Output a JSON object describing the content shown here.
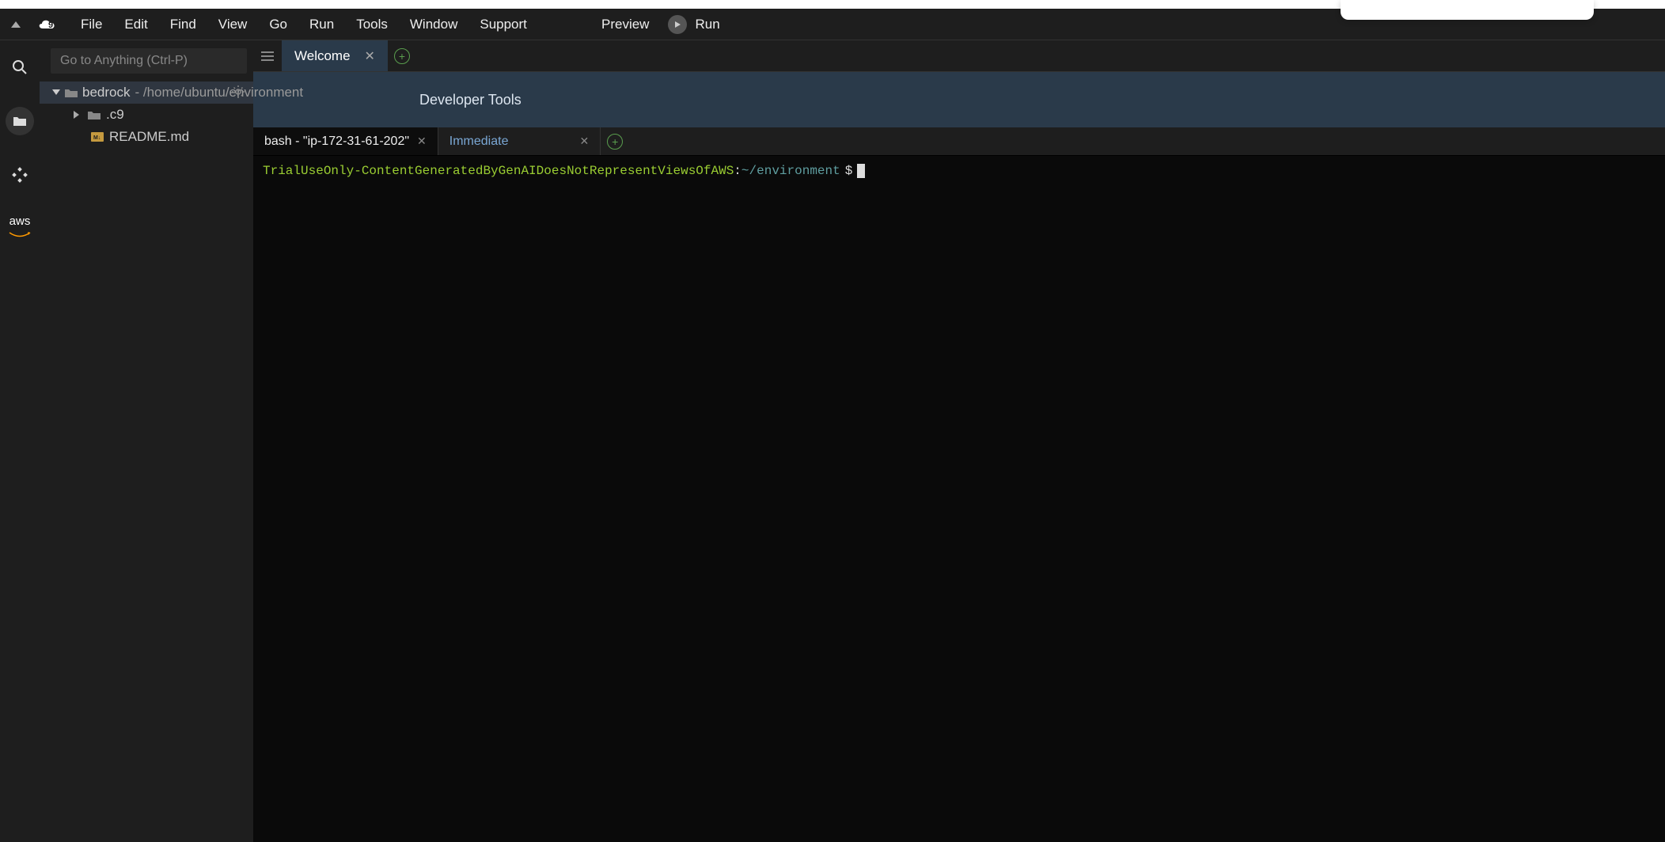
{
  "menubar": {
    "items": [
      "File",
      "Edit",
      "Find",
      "View",
      "Go",
      "Run",
      "Tools",
      "Window",
      "Support"
    ],
    "preview": "Preview",
    "run": "Run"
  },
  "sidebar": {
    "goto_placeholder": "Go to Anything (Ctrl-P)",
    "root": {
      "name": "bedrock",
      "path": " - /home/ubuntu/environment"
    },
    "children": [
      {
        "name": ".c9",
        "type": "folder",
        "expanded": false
      },
      {
        "name": "README.md",
        "type": "file"
      }
    ]
  },
  "rail": {
    "aws_label": "aws"
  },
  "editor": {
    "tabs": [
      {
        "label": "Welcome",
        "active": true
      }
    ]
  },
  "devtools": {
    "title": "Developer Tools"
  },
  "terminal": {
    "tabs": [
      {
        "label": "bash - \"ip-172-31-61-202\"",
        "active": true
      },
      {
        "label": "Immediate",
        "active": false
      }
    ],
    "prompt": {
      "user": "TrialUseOnly-ContentGeneratedByGenAIDoesNotRepresentViewsOfAWS",
      "colon": ":",
      "path": "~/environment",
      "dollar": "$"
    }
  }
}
